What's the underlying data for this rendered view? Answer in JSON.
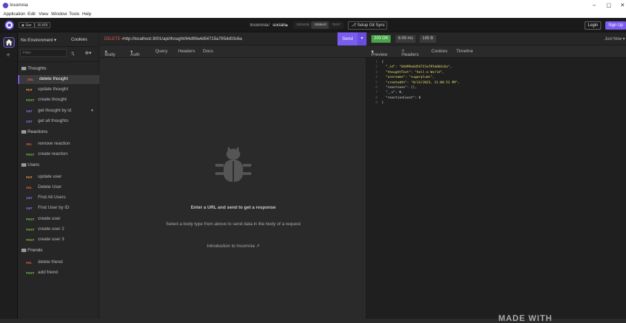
{
  "window": {
    "title": "Insomnia",
    "min": "–",
    "max": "▢",
    "close": "✕"
  },
  "menu": [
    "Application",
    "Edit",
    "View",
    "Window",
    "Tools",
    "Help"
  ],
  "topbar": {
    "star_label": "Star",
    "star_count": "30,805",
    "breadcrumb_root": "Insomnia",
    "breadcrumb_sep": "/",
    "breadcrumb_project": "socials",
    "modes": [
      "DESIGN",
      "DEBUG",
      "TEST"
    ],
    "git_sync": "Setup Git Sync",
    "login": "Login",
    "signup": "Sign Up"
  },
  "sidebar": {
    "environment": "No Environment",
    "cookies": "Cookies",
    "filter_placeholder": "Filter",
    "groups": [
      {
        "name": "Thoughts",
        "items": [
          {
            "method": "DEL",
            "name": "delete thought"
          },
          {
            "method": "PUT",
            "name": "update thought"
          },
          {
            "method": "POST",
            "name": "create thought"
          },
          {
            "method": "GET",
            "name": "get thought by id"
          },
          {
            "method": "GET",
            "name": "get all thoughts"
          }
        ]
      },
      {
        "name": "Reactions",
        "items": [
          {
            "method": "DEL",
            "name": "remove reaction"
          },
          {
            "method": "POST",
            "name": "create reaction"
          }
        ]
      },
      {
        "name": "Users",
        "items": [
          {
            "method": "PUT",
            "name": "update user"
          },
          {
            "method": "DEL",
            "name": "Delete User"
          },
          {
            "method": "GET",
            "name": "Find All Users"
          },
          {
            "method": "GET",
            "name": "Find User by ID"
          },
          {
            "method": "POST",
            "name": "create user"
          },
          {
            "method": "POST",
            "name": "create user 2"
          },
          {
            "method": "POST",
            "name": "create user 3"
          }
        ]
      },
      {
        "name": "Friends",
        "items": [
          {
            "method": "DEL",
            "name": "delete friend"
          },
          {
            "method": "POST",
            "name": "add friend"
          }
        ]
      }
    ]
  },
  "request": {
    "method": "DELETE",
    "url": "http://localhost:3001/api/thought/64d99a4d54715a795dd03c6a",
    "send": "Send",
    "tabs": [
      "Body",
      "Auth",
      "Query",
      "Headers",
      "Docs"
    ],
    "empty_title": "Enter a URL and send to get a response",
    "empty_sub": "Select a body type from above to send data in the body of a request",
    "empty_link": "Introduction to Insomnia"
  },
  "response": {
    "status": "200 OK",
    "time": "6.06 ms",
    "size": "165 B",
    "when": "Just Now",
    "tabs": [
      "Preview",
      "Headers",
      "Cookies",
      "Timeline"
    ],
    "headers_count": "7",
    "lines": [
      "{",
      "  \"_id\": \"64d99a4d54715a795dd03c6a\",",
      "  \"thoughtText\": \"hell-o World\",",
      "  \"username\": \"sugarplums\",",
      "  \"createdAt\": \"8/13/2023, 11:06:53 PM\",",
      "  \"reactions\": [],",
      "  \"__v\": 0,",
      "  \"reactionCount\": 0",
      "}"
    ]
  },
  "watermark": "MADE WITH",
  "colors": {
    "accent": "#7a5cf0",
    "ok": "#47a447",
    "del": "#e05a4f",
    "put": "#f2a338",
    "post": "#7bc943",
    "get": "#8a7bf0"
  }
}
